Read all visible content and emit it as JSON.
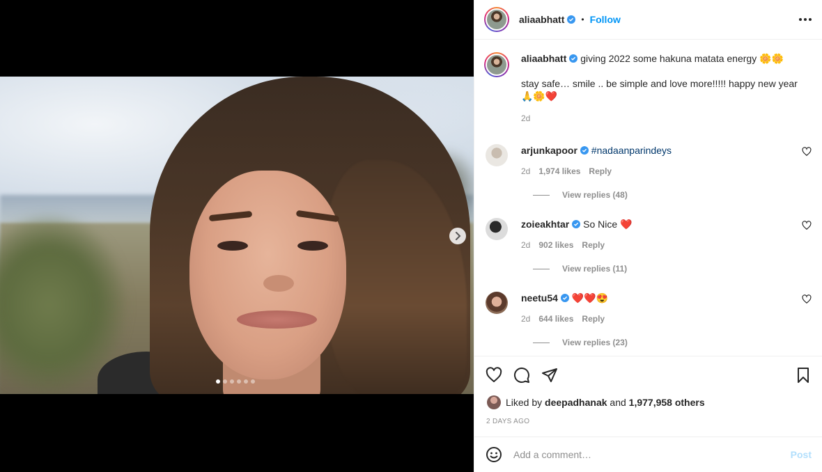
{
  "post": {
    "username": "aliaabhatt",
    "follow_label": "Follow",
    "dot": "•"
  },
  "caption": {
    "username": "aliaabhatt",
    "line1": "giving 2022 some hakuna matata energy 🌼🌼",
    "line2": "stay safe… smile .. be simple and love more!!!!! happy new year 🙏🌼❤️",
    "time": "2d"
  },
  "comments": [
    {
      "username": "arjunkapoor",
      "text": "#nadaanparindeys",
      "is_hashtag": true,
      "time": "2d",
      "likes": "1,974 likes",
      "reply": "Reply",
      "replies": "View replies (48)"
    },
    {
      "username": "zoieakhtar",
      "text": "So Nice ❤️",
      "is_hashtag": false,
      "time": "2d",
      "likes": "902 likes",
      "reply": "Reply",
      "replies": "View replies (11)"
    },
    {
      "username": "neetu54",
      "text": "❤️❤️😍",
      "is_hashtag": false,
      "time": "2d",
      "likes": "644 likes",
      "reply": "Reply",
      "replies": "View replies (23)"
    }
  ],
  "likes": {
    "prefix": "Liked by",
    "user": "deepadhanak",
    "and": "and",
    "others": "1,977,958 others"
  },
  "timestamp": "2 DAYS AGO",
  "add_comment": {
    "placeholder": "Add a comment…",
    "post_label": "Post"
  },
  "carousel": {
    "count": 6,
    "active": 0
  },
  "colors": {
    "follow": "#0095f6",
    "hashtag": "#00376b",
    "muted": "#8e8e8e",
    "verified": "#3897f0",
    "post_disabled": "#b2dffc"
  }
}
